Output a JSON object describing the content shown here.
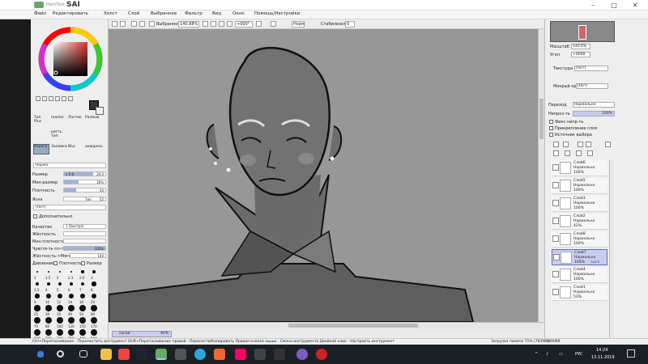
{
  "app": {
    "brand_small": "PaintTool",
    "brand": "SAI"
  },
  "menu": [
    "Файл",
    "Редактировать",
    "Холст",
    "Слой",
    "Выбранное",
    "Фильтр",
    "Вид",
    "Окно",
    "Помощь/Настройки"
  ],
  "toolbar": {
    "selection_label": "Выбранное",
    "zoom_value": "140.88%",
    "angle_value": "+000°",
    "mode_value": "Норм",
    "stabilizer_label": "Стабилизатор",
    "stabilizer_value": "0"
  },
  "leftpanel": {
    "tools_row1": [
      "Тип",
      "marker",
      "Ластик",
      "Размыв"
    ],
    "tools_row1b": [
      "Plus",
      "",
      "",
      ""
    ],
    "tools_row2": [
      "",
      "кисть",
      "",
      ""
    ],
    "tools_row2b": [
      "",
      "Тип",
      "",
      ""
    ],
    "tools_row3": [
      "Аэрогр",
      "Заливка",
      "Blur",
      "акварель"
    ],
    "mode_label": "Норма",
    "size_label": "Размер",
    "size_mult": "x 0.8",
    "size_value": "29.0",
    "minsize_label": "Мин размер",
    "minsize_value": "36%",
    "density_label": "Плотность",
    "density_value": "30",
    "shape_label": "Ясна",
    "shape_value_label": "Тип",
    "shape_value": "52",
    "texture_label": "[Нет]",
    "advanced_label": "Дополнительно",
    "quality_label": "Качество",
    "quality_value": "1 (Быстро)",
    "hardness_label": "Жёсткость",
    "minpressure_label": "Мин плотность",
    "pressure_label": "Чувств-ть пл-та",
    "pressure_value": "100%",
    "smooth_label": "Жёсткость->Мягко",
    "smooth_value": "100",
    "dyn_label": "Давление",
    "dyn_density": "Плотность",
    "dyn_size": "Размер",
    "dot_sizes": [
      "1",
      "1.5",
      "2",
      "2.3",
      "2.6",
      "3",
      "3.5",
      "4",
      "5",
      "6",
      "7",
      "8",
      "9",
      "10",
      "12",
      "14",
      "16",
      "20",
      "25",
      "30",
      "35",
      "40",
      "50",
      "60",
      "70",
      "80",
      "100",
      "120",
      "150",
      "170",
      "200",
      "250",
      "300",
      "350",
      "400",
      "500"
    ]
  },
  "document": {
    "name": "сосаи",
    "zoom": "40%"
  },
  "rightpanel": {
    "zoom_label": "Масштаб",
    "zoom_value": "140.6%",
    "angle_label": "Угол",
    "angle_value": "+0008",
    "texture_label": "Текстура",
    "texture_value": "[Нет]",
    "effect_label": "Мокрый край",
    "effect_value": "[Нет]",
    "blend_label": "Переход",
    "blend_value": "Нормально",
    "opacity_label": "Непроз-ть",
    "opacity_value": "100%",
    "protect_label": "Фикс непр-ть",
    "clip_label": "Прикрепление слоя",
    "source_label": "Источник выбора"
  },
  "layers": [
    {
      "name": "Слой6",
      "mode": "Нормально",
      "opacity": "100%",
      "lock": ""
    },
    {
      "name": "Слой5",
      "mode": "Нормально",
      "opacity": "100%",
      "lock": ""
    },
    {
      "name": "Слой3",
      "mode": "Нормально",
      "opacity": "100%",
      "lock": ""
    },
    {
      "name": "Слой2",
      "mode": "Нормально",
      "opacity": "42%",
      "lock": ""
    },
    {
      "name": "Слой8",
      "mode": "Нормально",
      "opacity": "100%",
      "lock": ""
    },
    {
      "name": "Слой7",
      "mode": "Нормально",
      "opacity": "100%",
      "lock": "Lock"
    },
    {
      "name": "Слой4",
      "mode": "Нормально",
      "opacity": "100%",
      "lock": ""
    },
    {
      "name": "Слой1",
      "mode": "Нормально",
      "opacity": "53%",
      "lock": ""
    }
  ],
  "statusbar": {
    "hints": "Ctrl+Перетаскивание - Переместить инструмент   Shift+Перетаскивание правой - Перенести/Копировать   Правая кнопка мыши - Смена инструмента   Двойной клик - Настроить инструмент",
    "memory": "Загрузка памяти 71% (783MB)",
    "disk": "890MB"
  },
  "taskbar": {
    "lang": "РУС",
    "time": "14:24",
    "date": "13.11.2019"
  }
}
